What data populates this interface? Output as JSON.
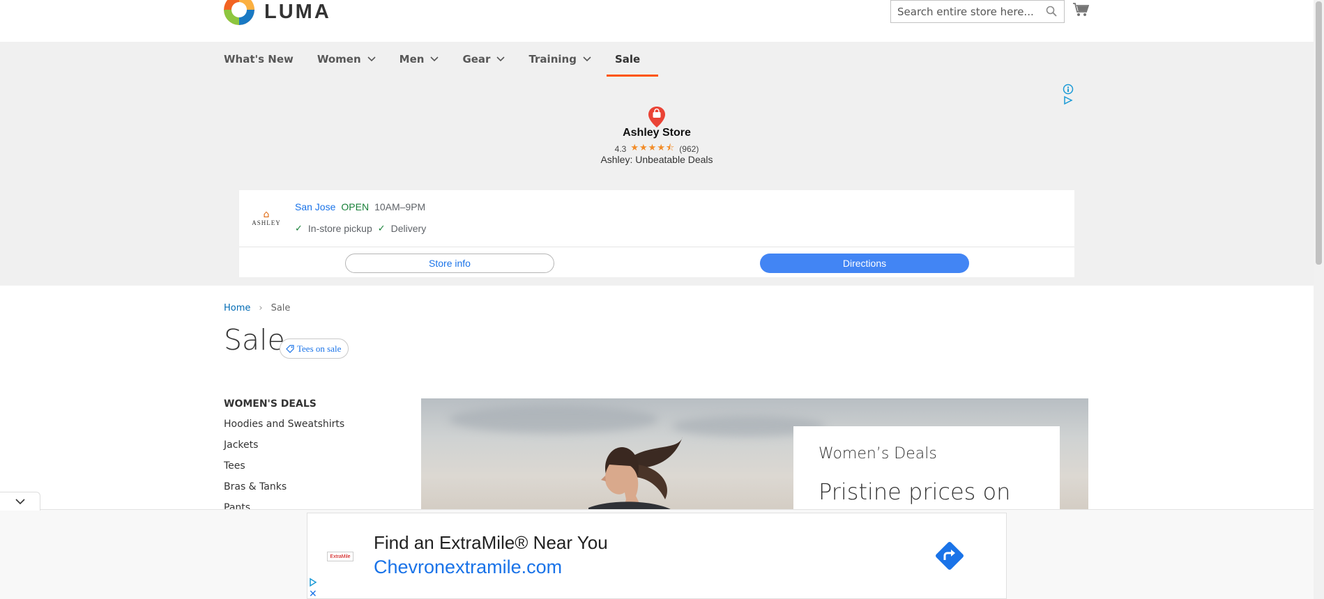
{
  "header": {
    "logo_text": "LUMA",
    "search_placeholder": "Search entire store here..."
  },
  "nav": {
    "items": [
      {
        "label": "What's New",
        "dropdown": false
      },
      {
        "label": "Women",
        "dropdown": true
      },
      {
        "label": "Men",
        "dropdown": true
      },
      {
        "label": "Gear",
        "dropdown": true
      },
      {
        "label": "Training",
        "dropdown": true
      },
      {
        "label": "Sale",
        "dropdown": false,
        "active": true
      }
    ]
  },
  "ad_top": {
    "store_name": "Ashley Store",
    "rating": "4.3",
    "stars": "★★★★⯪",
    "review_count": "(962)",
    "tagline": "Ashley: Unbeatable Deals",
    "brand_logo_text": "ASHLEY",
    "city": "San Jose",
    "status": "OPEN",
    "hours": "10AM–9PM",
    "feature_1": "In-store pickup",
    "feature_2": "Delivery",
    "store_info_label": "Store info",
    "directions_label": "Directions"
  },
  "breadcrumbs": {
    "home": "Home",
    "separator": "›",
    "current": "Sale"
  },
  "page": {
    "title": "Sale",
    "tag_label": "Tees on sale"
  },
  "sidebar": {
    "title": "WOMEN'S DEALS",
    "items": [
      "Hoodies and Sweatshirts",
      "Jackets",
      "Tees",
      "Bras & Tanks",
      "Pants"
    ]
  },
  "hero": {
    "kicker": "Women’s Deals",
    "headline": "Pristine prices on"
  },
  "ad_bottom": {
    "logo_text": "ExtraMile",
    "headline": "Find an ExtraMile® Near You",
    "url": "Chevronextramile.com"
  },
  "colors": {
    "accent": "#ff5501",
    "link": "#006bb4",
    "ad_blue": "#1a73e8",
    "directions_button": "#4285f4",
    "open_green": "#188038"
  }
}
